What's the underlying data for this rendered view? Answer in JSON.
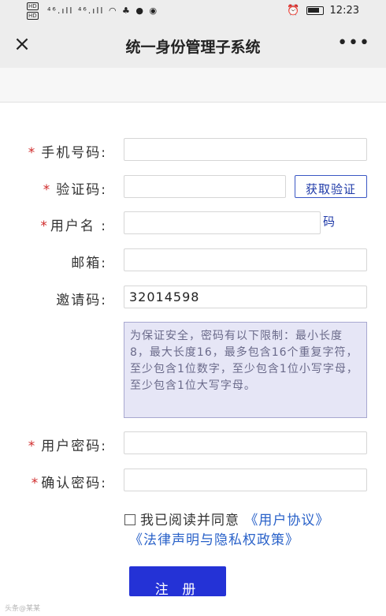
{
  "status": {
    "hd1": "HD",
    "hd2": "HD",
    "signal_icons": "⁴⁶.ıll ⁴⁶.ıll ◠ ♣ ● ◉",
    "time": "12:23",
    "alarm_icon": "alarm-icon"
  },
  "titlebar": {
    "close": "×",
    "title": "统一身份管理子系统",
    "more": "•••"
  },
  "form": {
    "required_mark": "*",
    "phone_label": "手机号码:",
    "code_label": "验证码:",
    "get_code_button": "获取验证",
    "get_code_button_tail": "码",
    "username_label": "用户名 :",
    "email_label": "邮箱:",
    "invite_label": "邀请码:",
    "invite_value": "32014598",
    "password_notice": "为保证安全，密码有以下限制：最小长度8，最大长度16，最多包含16个重复字符，至少包含1位数字，至少包含1位小写字母，至少包含1位大写字母。",
    "password_label": "用户密码:",
    "confirm_label": "确认密码:",
    "agree_text": "我已阅读并同意",
    "user_agreement_link": "《用户协议》",
    "privacy_link": "《法律声明与隐私权政策》",
    "submit_label": "注 册"
  },
  "watermark": "头条@某某"
}
